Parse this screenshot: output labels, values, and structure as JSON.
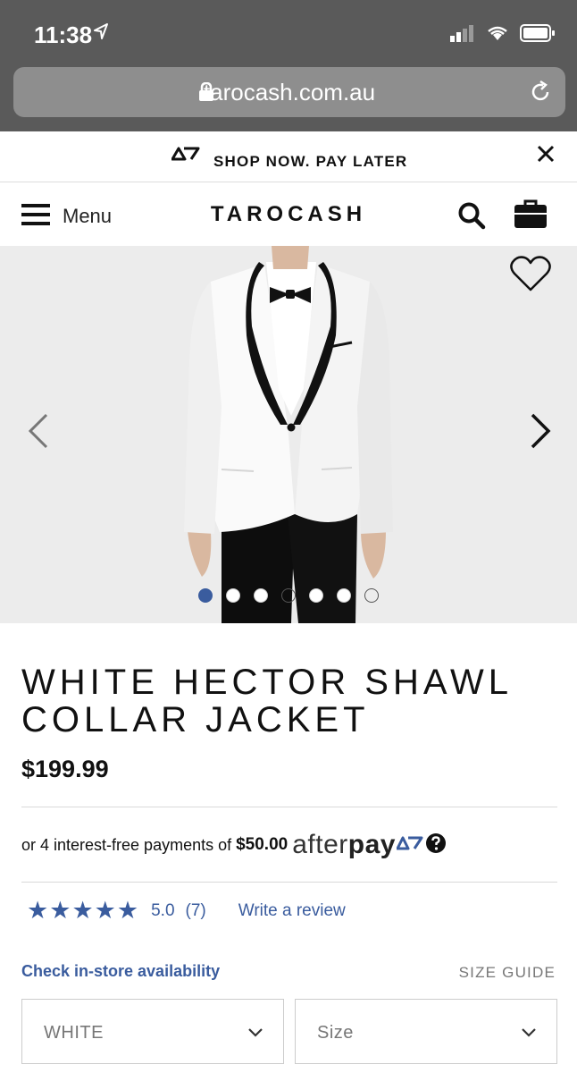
{
  "status_bar": {
    "time": "11:38"
  },
  "browser": {
    "url": "tarocash.com.au"
  },
  "promo": {
    "text": "SHOP NOW. PAY LATER"
  },
  "header": {
    "menu_label": "Menu",
    "brand": "TAROCASH"
  },
  "gallery": {
    "image_count": 7,
    "active_index": 0
  },
  "product": {
    "title": "WHITE HECTOR SHAWL COLLAR JACKET",
    "price": "$199.99",
    "afterpay": {
      "text": "or 4 interest-free payments of",
      "amount": "$50.00",
      "logo_left": "after",
      "logo_right": "pay"
    },
    "rating": {
      "stars": 5,
      "value": "5.0",
      "count": "(7)",
      "review_link": "Write a review"
    },
    "store_link": "Check in-store availability",
    "size_guide": "SIZE GUIDE",
    "colour_select": "WHITE",
    "size_select": "Size"
  },
  "colors": {
    "accent": "#3a5c9e",
    "chrome": "#5a5a5a"
  }
}
